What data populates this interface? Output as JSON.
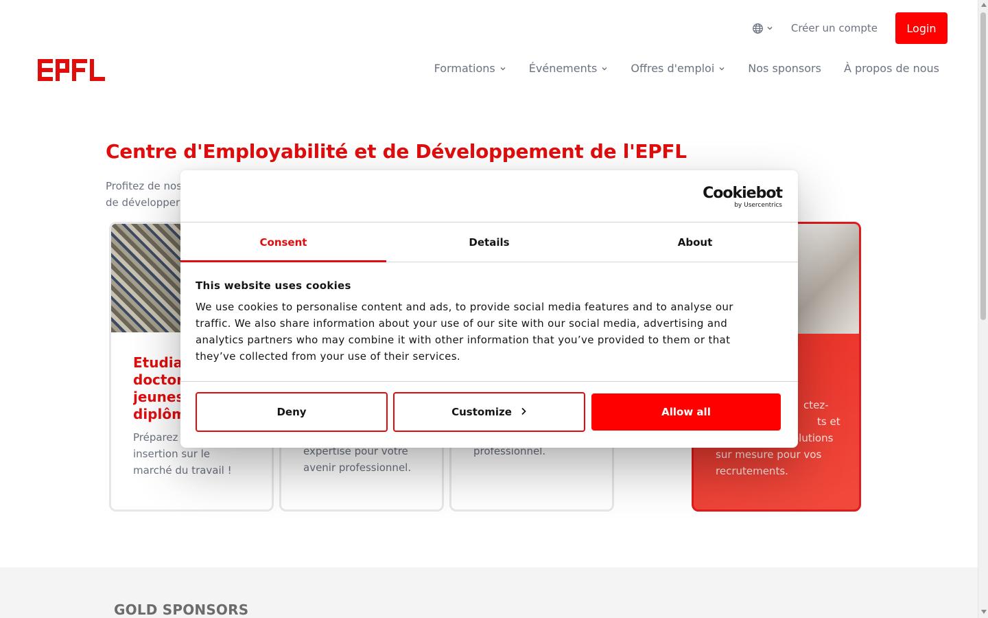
{
  "header": {
    "logo_text": "EPFL",
    "create_account": "Créer un compte",
    "login": "Login"
  },
  "nav": {
    "items": [
      {
        "label": "Formations",
        "has_menu": true
      },
      {
        "label": "Événements",
        "has_menu": true
      },
      {
        "label": "Offres d'emploi",
        "has_menu": true
      },
      {
        "label": "Nos sponsors",
        "has_menu": false
      },
      {
        "label": "À propos de nous",
        "has_menu": false
      }
    ]
  },
  "hero": {
    "title": "Centre d'Employabilité et de Développement de l'EPFL",
    "subtitle_line1": "Profitez de nos",
    "subtitle_line2": "de développer"
  },
  "cards": [
    {
      "title_lines": [
        "Etudiar",
        "doctora",
        "jeunes",
        "diplôm"
      ],
      "text_lines": [
        "Préparez",
        "insertion sur le",
        "marché du travail !"
      ]
    },
    {
      "text_lines": [
        "expertise pour votre",
        "avenir professionnel."
      ]
    },
    {
      "text_lines": [
        "professionnel."
      ]
    },
    {
      "text_lines": [
        "ctez-",
        "ts et",
        "olutions",
        "sur mesure pour vos",
        "recrutements."
      ]
    }
  ],
  "sponsors": {
    "title": "GOLD SPONSORS"
  },
  "cookie_dialog": {
    "brand": "Cookiebot",
    "brand_sub": "by Usercentrics",
    "tabs": [
      "Consent",
      "Details",
      "About"
    ],
    "active_tab": "Consent",
    "title": "This website uses cookies",
    "body": "We use cookies to personalise content and ads, to provide social media features and to analyse our traffic. We also share information about your use of our site with our social media, advertising and analytics partners who may combine it with other information that you’ve provided to them or that they’ve collected from your use of their services.",
    "buttons": {
      "deny": "Deny",
      "customize": "Customize",
      "allow": "Allow all"
    }
  },
  "colors": {
    "brand_red": "#ff0000",
    "title_red": "#e10d0d",
    "muted_text": "#6b7280"
  },
  "icons": [
    "globe-icon",
    "chevron-down-icon",
    "chevron-right-icon"
  ]
}
